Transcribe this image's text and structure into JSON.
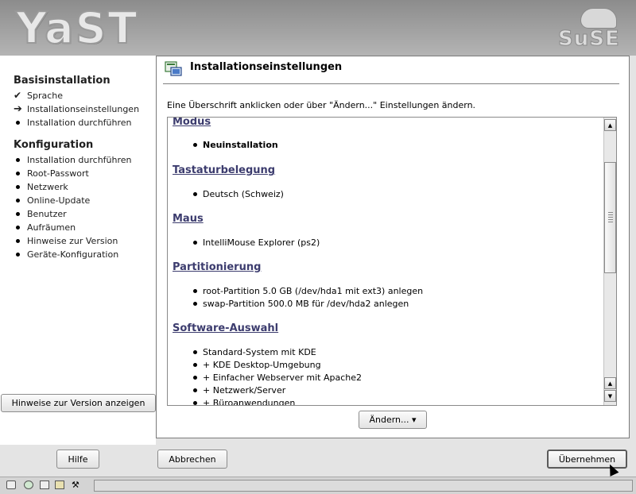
{
  "banner": {
    "logo_text": "YaST",
    "vendor_text": "SuSE"
  },
  "sidebar": {
    "section1_title": "Basisinstallation",
    "section1_steps": [
      {
        "label": "Sprache",
        "state": "done"
      },
      {
        "label": "Installationseinstellungen",
        "state": "current"
      },
      {
        "label": "Installation durchführen",
        "state": "todo"
      }
    ],
    "section2_title": "Konfiguration",
    "section2_steps": [
      {
        "label": "Installation durchführen"
      },
      {
        "label": "Root-Passwort"
      },
      {
        "label": "Netzwerk"
      },
      {
        "label": "Online-Update"
      },
      {
        "label": "Benutzer"
      },
      {
        "label": "Aufräumen"
      },
      {
        "label": "Hinweise zur Version"
      },
      {
        "label": "Geräte-Konfiguration"
      }
    ],
    "release_notes_button": "Hinweise zur Version anzeigen"
  },
  "main": {
    "title": "Installationseinstellungen",
    "instruction": "Eine Überschrift anklicken oder über \"Ändern...\" Einstellungen ändern.",
    "sections": [
      {
        "heading": "Modus",
        "items": [
          "Neuinstallation"
        ]
      },
      {
        "heading": "Tastaturbelegung",
        "items": [
          "Deutsch (Schweiz)"
        ]
      },
      {
        "heading": "Maus",
        "items": [
          "IntelliMouse Explorer (ps2)"
        ]
      },
      {
        "heading": "Partitionierung",
        "items": [
          "root-Partition 5.0 GB (/dev/hda1 mit ext3) anlegen",
          "swap-Partition 500.0 MB für /dev/hda2 anlegen"
        ]
      },
      {
        "heading": "Software-Auswahl",
        "items": [
          "Standard-System mit KDE",
          "+ KDE Desktop-Umgebung",
          "+ Einfacher Webserver mit Apache2",
          "+ Netzwerk/Server",
          "+ Büroanwendungen"
        ]
      }
    ],
    "change_button": "Ändern... ▾"
  },
  "footer": {
    "help_button": "Hilfe",
    "cancel_button": "Abbrechen",
    "accept_button": "Übernehmen"
  }
}
